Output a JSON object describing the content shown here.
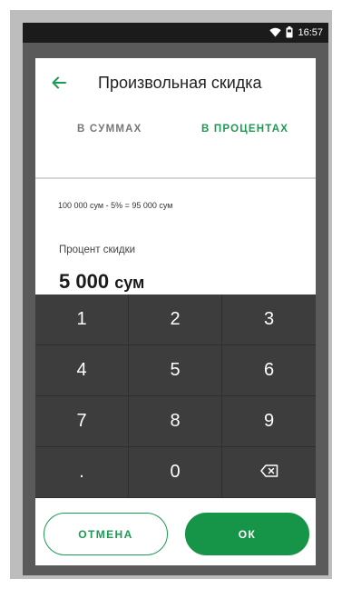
{
  "statusbar": {
    "time": "16:57",
    "wifi_icon": "wifi-icon",
    "battery_icon": "battery-icon"
  },
  "dialog": {
    "title": "Произвольная скидка",
    "back_icon": "arrow-left-icon",
    "tabs": [
      {
        "label": "В СУММАХ",
        "active": false
      },
      {
        "label": "В ПРОЦЕНТАХ",
        "active": true
      }
    ],
    "formula": "100 000 сум - 5% = 95 000 сум",
    "field_label": "Процент скидки",
    "amount_value": "5 000",
    "amount_currency": "сум"
  },
  "keypad": {
    "keys": [
      "1",
      "2",
      "3",
      "4",
      "5",
      "6",
      "7",
      "8",
      "9",
      ".",
      "0"
    ],
    "backspace_icon": "backspace-icon"
  },
  "actions": {
    "cancel_label": "ОТМЕНА",
    "ok_label": "ОК"
  },
  "colors": {
    "accent": "#1b9a52",
    "keypad_bg": "#3d3d3d",
    "statusbar_bg": "#1b1b1b"
  }
}
